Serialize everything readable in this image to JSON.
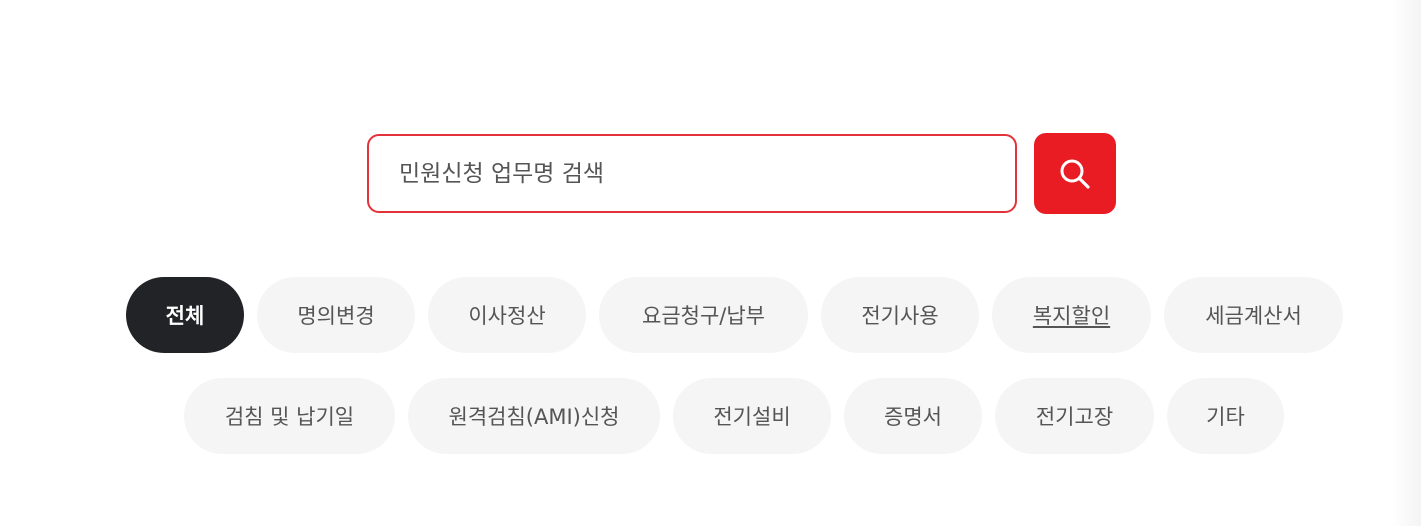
{
  "search": {
    "placeholder": "민원신청 업무명 검색"
  },
  "icons": {
    "search_button": "search-icon"
  },
  "colors": {
    "accent": "#e91c24",
    "active_chip": "#222326",
    "chip_background": "#f5f5f5"
  },
  "filters": {
    "active": "전체",
    "row1": [
      "전체",
      "명의변경",
      "이사정산",
      "요금청구/납부",
      "전기사용",
      "복지할인",
      "세금계산서"
    ],
    "row2": [
      "검침 및 납기일",
      "원격검침(AMI)신청",
      "전기설비",
      "증명서",
      "전기고장",
      "기타"
    ]
  }
}
